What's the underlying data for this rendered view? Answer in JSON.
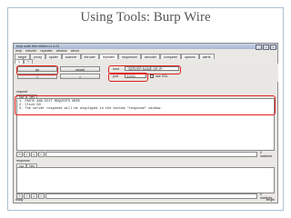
{
  "slide": {
    "title": "Using Tools: Burp Wire"
  },
  "window": {
    "title": "burp suite free edition v1.4.01",
    "controls": [
      "_",
      "□",
      "x"
    ]
  },
  "menu": [
    "burp",
    "intruder",
    "repeater",
    "window",
    "about"
  ],
  "tabs": [
    "target",
    "proxy",
    "spider",
    "scanner",
    "intruder",
    "repeater",
    "sequencer",
    "decoder",
    "comparer",
    "options",
    "alerts"
  ],
  "selected_tab": "repeater",
  "request_tabs": [
    "1",
    "+"
  ],
  "toolbar": {
    "go_label": "go",
    "cancel_label": "cancel",
    "back_label": "<",
    "forward_label": ">",
    "host_label": "host",
    "host_value": "~SERVER NAME OR IP~",
    "port_label": "port",
    "port_value": "31041",
    "ssl_label": "use SSL"
  },
  "request": {
    "header": "request",
    "subtabs": [
      "raw",
      "hex"
    ],
    "lines": [
      "1. PASTE AND EDIT REQUESTS HERE",
      "2. Click GO",
      "3. The server response will be displayed in the bottom \"response\" window."
    ],
    "search": {
      "prev": "?",
      "back": "<",
      "plus": "+",
      "next": ">",
      "matches": "0 matches"
    }
  },
  "response": {
    "header": "response",
    "subtabs": [
      "raw",
      "hex"
    ],
    "search": {
      "prev": "?",
      "back": "<",
      "plus": "+",
      "next": ">",
      "matches": "0 matches"
    }
  },
  "status": {
    "left": "ready",
    "right": "length"
  }
}
